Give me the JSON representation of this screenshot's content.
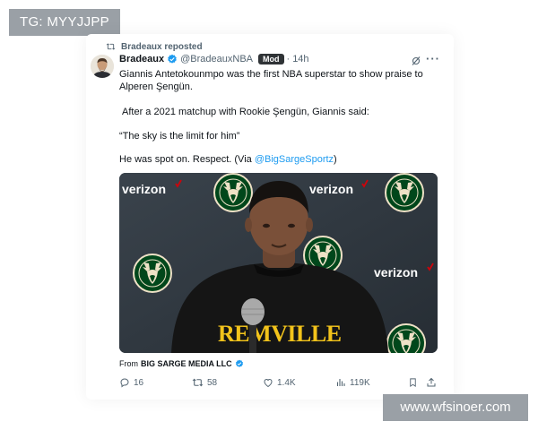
{
  "badges": {
    "tg": "TG: MYYJJPP",
    "website": "www.wfsinoer.com"
  },
  "repost": {
    "label": "Bradeaux reposted"
  },
  "post": {
    "display_name": "Bradeaux",
    "handle": "@BradeauxNBA",
    "mod_badge": "Mod",
    "separator": "·",
    "time": "14h",
    "more": "···",
    "lines": [
      "Giannis Antetokounmpo was the first NBA superstar to show praise to",
      "Alperen Şengün.",
      "After a 2021 matchup with Rookie Şengün, Giannis said:",
      "“The sky is the limit for him”",
      "He was spot on. Respect. (Via "
    ],
    "mention": "@BigSargeSportz",
    "closing": ")"
  },
  "media": {
    "sponsor": "verizon",
    "shirt_text": "DREAMVILLE",
    "shirt_text_visible": "REMVILLE"
  },
  "source": {
    "prefix": "From",
    "name": "BIG SARGE MEDIA LLC"
  },
  "actions": {
    "replies": "16",
    "reposts": "58",
    "likes": "1.4K",
    "views": "119K"
  },
  "colors": {
    "accent": "#1d9bf0",
    "verified": "#1d9bf0",
    "text": "#0f1419",
    "muted": "#536471",
    "badge_bg": "#9aa0a6",
    "verizon_red": "#cd040b",
    "bucks_green": "#00471b",
    "shirt_yellow": "#f2c31b"
  },
  "icons": {
    "repost": "repost-icon",
    "verified": "verified-badge-icon",
    "grok": "grok-icon",
    "more": "more-icon",
    "reply": "reply-icon",
    "retweet": "retweet-icon",
    "like": "heart-icon",
    "views": "views-icon",
    "bookmark": "bookmark-icon",
    "share": "share-icon"
  }
}
